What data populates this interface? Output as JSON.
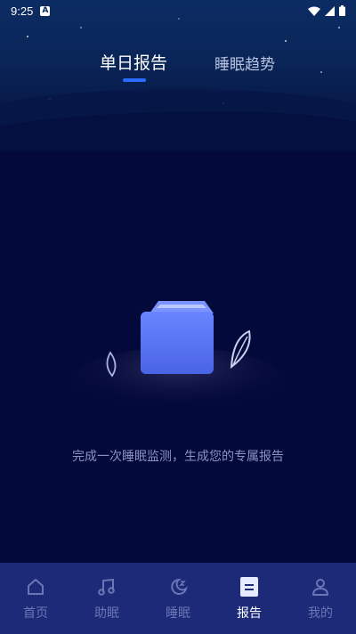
{
  "status_bar": {
    "time": "9:25",
    "notification_icon": "A"
  },
  "tabs": [
    {
      "label": "单日报告",
      "active": true
    },
    {
      "label": "睡眠趋势",
      "active": false
    }
  ],
  "empty_state": {
    "message": "完成一次睡眠监测，生成您的专属报告"
  },
  "bottom_nav": {
    "items": [
      {
        "label": "首页",
        "icon": "home-icon",
        "active": false
      },
      {
        "label": "助眠",
        "icon": "music-note-icon",
        "active": false
      },
      {
        "label": "睡眠",
        "icon": "moon-icon",
        "active": false
      },
      {
        "label": "报告",
        "icon": "report-icon",
        "active": true
      },
      {
        "label": "我的",
        "icon": "profile-icon",
        "active": false
      }
    ]
  },
  "colors": {
    "background": "#03093a",
    "accent": "#2a6cff",
    "nav_bg": "#1d2a78",
    "muted_text": "#8a93c0"
  }
}
